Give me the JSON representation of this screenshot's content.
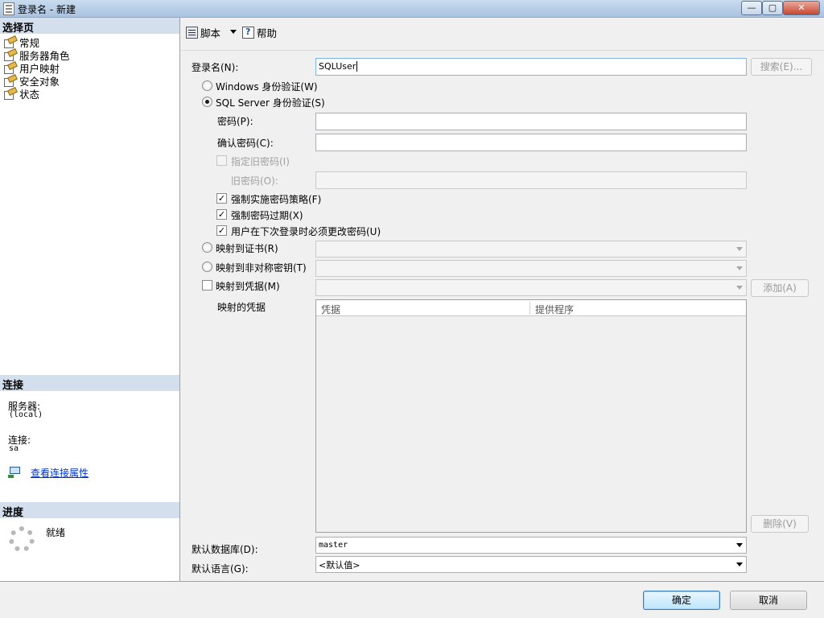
{
  "window": {
    "title": "登录名 - 新建",
    "controls": {
      "minimize": "—",
      "maximize": "▢",
      "close": "✕"
    }
  },
  "left": {
    "select_page_header": "选择页",
    "pages": [
      "常规",
      "服务器角色",
      "用户映射",
      "安全对象",
      "状态"
    ],
    "connection_header": "连接",
    "server_label": "服务器:",
    "server_value": "(local)",
    "connection_label": "连接:",
    "connection_value": "sa",
    "view_props_link": "查看连接属性",
    "progress_header": "进度",
    "progress_status": "就绪"
  },
  "toolbar": {
    "script_label": "脚本",
    "help_label": "帮助"
  },
  "form": {
    "login_name_label": "登录名(N):",
    "login_name_value": "SQLUser",
    "search_button": "搜索(E)...",
    "windows_auth": "Windows 身份验证(W)",
    "sql_auth": "SQL Server 身份验证(S)",
    "password_label": "密码(P):",
    "confirm_password_label": "确认密码(C):",
    "specify_old_password": "指定旧密码(I)",
    "old_password_label": "旧密码(O):",
    "enforce_policy": "强制实施密码策略(F)",
    "enforce_expiration": "强制密码过期(X)",
    "must_change": "用户在下次登录时必须更改密码(U)",
    "map_cert": "映射到证书(R)",
    "map_asym_key": "映射到非对称密钥(T)",
    "map_credential": "映射到凭据(M)",
    "add_button": "添加(A)",
    "mapped_credentials_label": "映射的凭据",
    "grid_columns": [
      "凭据",
      "提供程序"
    ],
    "remove_button": "删除(V)",
    "default_db_label": "默认数据库(D):",
    "default_db_value": "master",
    "default_lang_label": "默认语言(G):",
    "default_lang_value": "<默认值>"
  },
  "state": {
    "windows_auth_selected": false,
    "sql_auth_selected": true,
    "specify_old_password_checked": false,
    "enforce_policy_checked": true,
    "enforce_expiration_checked": true,
    "must_change_checked": true,
    "map_credential_checked": false
  },
  "buttons": {
    "ok": "确定",
    "cancel": "取消"
  }
}
